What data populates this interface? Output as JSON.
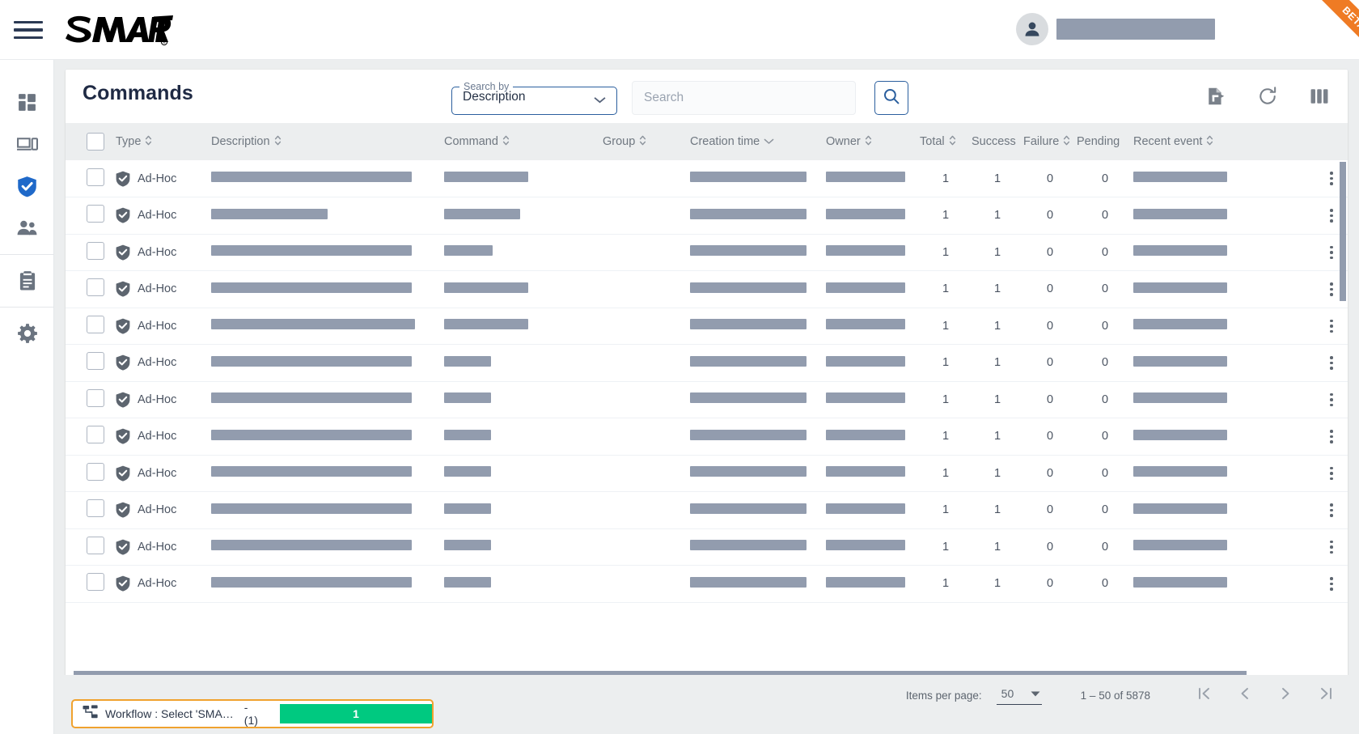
{
  "brand": {
    "name": "SMART",
    "registered": "®"
  },
  "ribbon": {
    "label": "BETA",
    "color": "#ef7b24"
  },
  "topbar": {
    "menu_icon": "hamburger-icon",
    "avatar_icon": "user-avatar-icon",
    "user_name": ""
  },
  "sidebar": {
    "items": [
      {
        "icon": "dashboard-grid-icon",
        "name": "dashboard",
        "active": false
      },
      {
        "icon": "devices-icon",
        "name": "devices",
        "active": false
      },
      {
        "icon": "shield-check-icon",
        "name": "security",
        "active": true
      },
      {
        "icon": "users-icon",
        "name": "users",
        "active": false
      },
      {
        "icon": "clipboard-icon",
        "name": "reports",
        "active": false
      },
      {
        "icon": "gear-icon",
        "name": "settings",
        "active": false
      }
    ],
    "active_color": "#1f69c9"
  },
  "header": {
    "title": "Commands",
    "search_by": {
      "legend": "Search by",
      "value": "Description",
      "caret": "chevron-down-icon"
    },
    "search": {
      "placeholder": "Search",
      "value": ""
    },
    "search_button_icon": "search-icon",
    "tools": [
      {
        "icon": "export-file-icon",
        "name": "export"
      },
      {
        "icon": "refresh-icon",
        "name": "refresh"
      },
      {
        "icon": "columns-icon",
        "name": "column-settings"
      }
    ]
  },
  "table": {
    "columns": [
      {
        "label": "",
        "key": "select",
        "sort": "none"
      },
      {
        "label": "Type",
        "key": "type",
        "sort": "both"
      },
      {
        "label": "Description",
        "key": "description",
        "sort": "both"
      },
      {
        "label": "Command",
        "key": "command",
        "sort": "both"
      },
      {
        "label": "Group",
        "key": "group",
        "sort": "both"
      },
      {
        "label": "Creation time",
        "key": "creation_time",
        "sort": "desc"
      },
      {
        "label": "Owner",
        "key": "owner",
        "sort": "both"
      },
      {
        "label": "Total",
        "key": "total",
        "sort": "both"
      },
      {
        "label": "Success",
        "key": "success",
        "sort": "none"
      },
      {
        "label": "Failure",
        "key": "failure",
        "sort": "both"
      },
      {
        "label": "Pending",
        "key": "pending",
        "sort": "none"
      },
      {
        "label": "Recent event",
        "key": "recent_event",
        "sort": "both"
      }
    ],
    "rows": [
      {
        "type": "Ad-Hoc",
        "desc_w": 248,
        "cmd_w": 104,
        "group": "",
        "time_w": 144,
        "owner_w": 98,
        "total": "1",
        "success": "1",
        "failure": "0",
        "pending": "0",
        "recent_w": 116
      },
      {
        "type": "Ad-Hoc",
        "desc_w": 144,
        "cmd_w": 94,
        "group": "",
        "time_w": 144,
        "owner_w": 98,
        "total": "1",
        "success": "1",
        "failure": "0",
        "pending": "0",
        "recent_w": 116
      },
      {
        "type": "Ad-Hoc",
        "desc_w": 248,
        "cmd_w": 60,
        "group": "",
        "time_w": 144,
        "owner_w": 98,
        "total": "1",
        "success": "1",
        "failure": "0",
        "pending": "0",
        "recent_w": 116
      },
      {
        "type": "Ad-Hoc",
        "desc_w": 248,
        "cmd_w": 104,
        "group": "",
        "time_w": 144,
        "owner_w": 98,
        "total": "1",
        "success": "1",
        "failure": "0",
        "pending": "0",
        "recent_w": 116
      },
      {
        "type": "Ad-Hoc",
        "desc_w": 252,
        "cmd_w": 104,
        "group": "",
        "time_w": 144,
        "owner_w": 98,
        "total": "1",
        "success": "1",
        "failure": "0",
        "pending": "0",
        "recent_w": 116
      },
      {
        "type": "Ad-Hoc",
        "desc_w": 248,
        "cmd_w": 58,
        "group": "",
        "time_w": 144,
        "owner_w": 98,
        "total": "1",
        "success": "1",
        "failure": "0",
        "pending": "0",
        "recent_w": 116
      },
      {
        "type": "Ad-Hoc",
        "desc_w": 248,
        "cmd_w": 58,
        "group": "",
        "time_w": 144,
        "owner_w": 98,
        "total": "1",
        "success": "1",
        "failure": "0",
        "pending": "0",
        "recent_w": 116
      },
      {
        "type": "Ad-Hoc",
        "desc_w": 248,
        "cmd_w": 58,
        "group": "",
        "time_w": 144,
        "owner_w": 98,
        "total": "1",
        "success": "1",
        "failure": "0",
        "pending": "0",
        "recent_w": 116
      },
      {
        "type": "Ad-Hoc",
        "desc_w": 248,
        "cmd_w": 58,
        "group": "",
        "time_w": 144,
        "owner_w": 98,
        "total": "1",
        "success": "1",
        "failure": "0",
        "pending": "0",
        "recent_w": 116
      },
      {
        "type": "Ad-Hoc",
        "desc_w": 248,
        "cmd_w": 58,
        "group": "",
        "time_w": 144,
        "owner_w": 98,
        "total": "1",
        "success": "1",
        "failure": "0",
        "pending": "0",
        "recent_w": 116
      },
      {
        "type": "Ad-Hoc",
        "desc_w": 248,
        "cmd_w": 58,
        "group": "",
        "time_w": 144,
        "owner_w": 98,
        "total": "1",
        "success": "1",
        "failure": "0",
        "pending": "0",
        "recent_w": 116
      },
      {
        "type": "Ad-Hoc",
        "desc_w": 248,
        "cmd_w": 58,
        "group": "",
        "time_w": 144,
        "owner_w": 98,
        "total": "1",
        "success": "1",
        "failure": "0",
        "pending": "0",
        "recent_w": 116
      }
    ],
    "row_type_icon": "shield-check-icon",
    "row_menu_icon": "kebab-menu-icon"
  },
  "paginator": {
    "items_per_page_label": "Items per page:",
    "items_per_page_value": "50",
    "range_label": "1 – 50 of 5878",
    "buttons": [
      {
        "icon": "first-page-icon",
        "name": "first-page"
      },
      {
        "icon": "previous-page-icon",
        "name": "previous-page"
      },
      {
        "icon": "next-page-icon",
        "name": "next-page"
      },
      {
        "icon": "last-page-icon",
        "name": "last-page"
      }
    ]
  },
  "download_chip": {
    "icon": "workflow-icon",
    "label": "Workflow : Select 'SMA…",
    "count": "- (1)",
    "progress_text": "1",
    "progress_color": "#00c980",
    "border_color": "#f0a22e"
  }
}
